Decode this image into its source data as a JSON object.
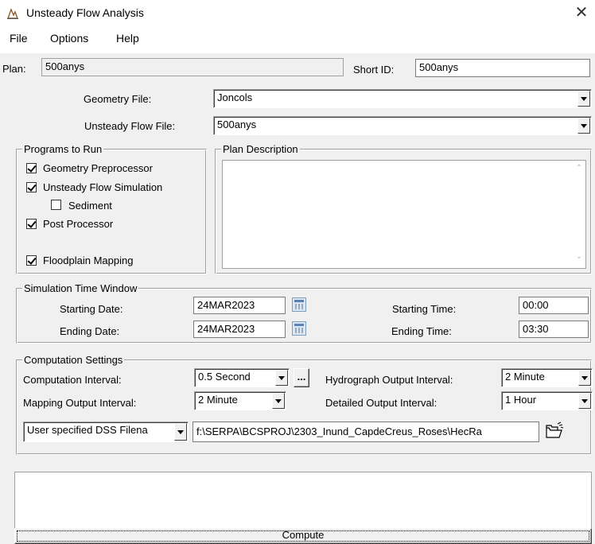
{
  "window": {
    "title": "Unsteady Flow Analysis",
    "close": "✕"
  },
  "menu": {
    "file": "File",
    "options": "Options",
    "help": "Help"
  },
  "plan": {
    "label": "Plan:",
    "value": "500anys",
    "short_id_label": "Short ID:",
    "short_id_value": "500anys"
  },
  "geometry": {
    "label": "Geometry File:",
    "value": "Joncols"
  },
  "unsteady": {
    "label": "Unsteady Flow File:",
    "value": "500anys"
  },
  "programs": {
    "title": "Programs to Run",
    "geometry_preprocessor": {
      "label": "Geometry Preprocessor",
      "checked": true
    },
    "unsteady_flow_simulation": {
      "label": "Unsteady Flow Simulation",
      "checked": true
    },
    "sediment": {
      "label": "Sediment",
      "checked": false
    },
    "post_processor": {
      "label": "Post Processor",
      "checked": true
    },
    "floodplain_mapping": {
      "label": "Floodplain Mapping",
      "checked": true
    }
  },
  "plan_description": {
    "title": "Plan Description",
    "value": ""
  },
  "simulation": {
    "title": "Simulation Time Window",
    "starting_date_label": "Starting Date:",
    "starting_date": "24MAR2023",
    "ending_date_label": "Ending Date:",
    "ending_date": "24MAR2023",
    "starting_time_label": "Starting Time:",
    "starting_time": "00:00",
    "ending_time_label": "Ending Time:",
    "ending_time": "03:30"
  },
  "computation": {
    "title": "Computation Settings",
    "computation_interval_label": "Computation Interval:",
    "computation_interval": "0.5 Second",
    "more_button": "...",
    "hydrograph_label": "Hydrograph Output Interval:",
    "hydrograph_interval": "2 Minute",
    "mapping_label": "Mapping Output Interval:",
    "mapping_interval": "2 Minute",
    "detailed_label": "Detailed Output Interval:",
    "detailed_interval": "1 Hour",
    "dss_option": "User specified DSS Filena",
    "dss_path": "f:\\SERPA\\BCSPROJ\\2303_Inund_CapdeCreus_Roses\\HecRa"
  },
  "output_log": "",
  "compute_button": "Compute",
  "icons": {
    "app": "hec-ras-app-icon",
    "calendar": "calendar-icon",
    "folder": "open-folder-icon",
    "dropdown": "chevron-down-icon"
  }
}
